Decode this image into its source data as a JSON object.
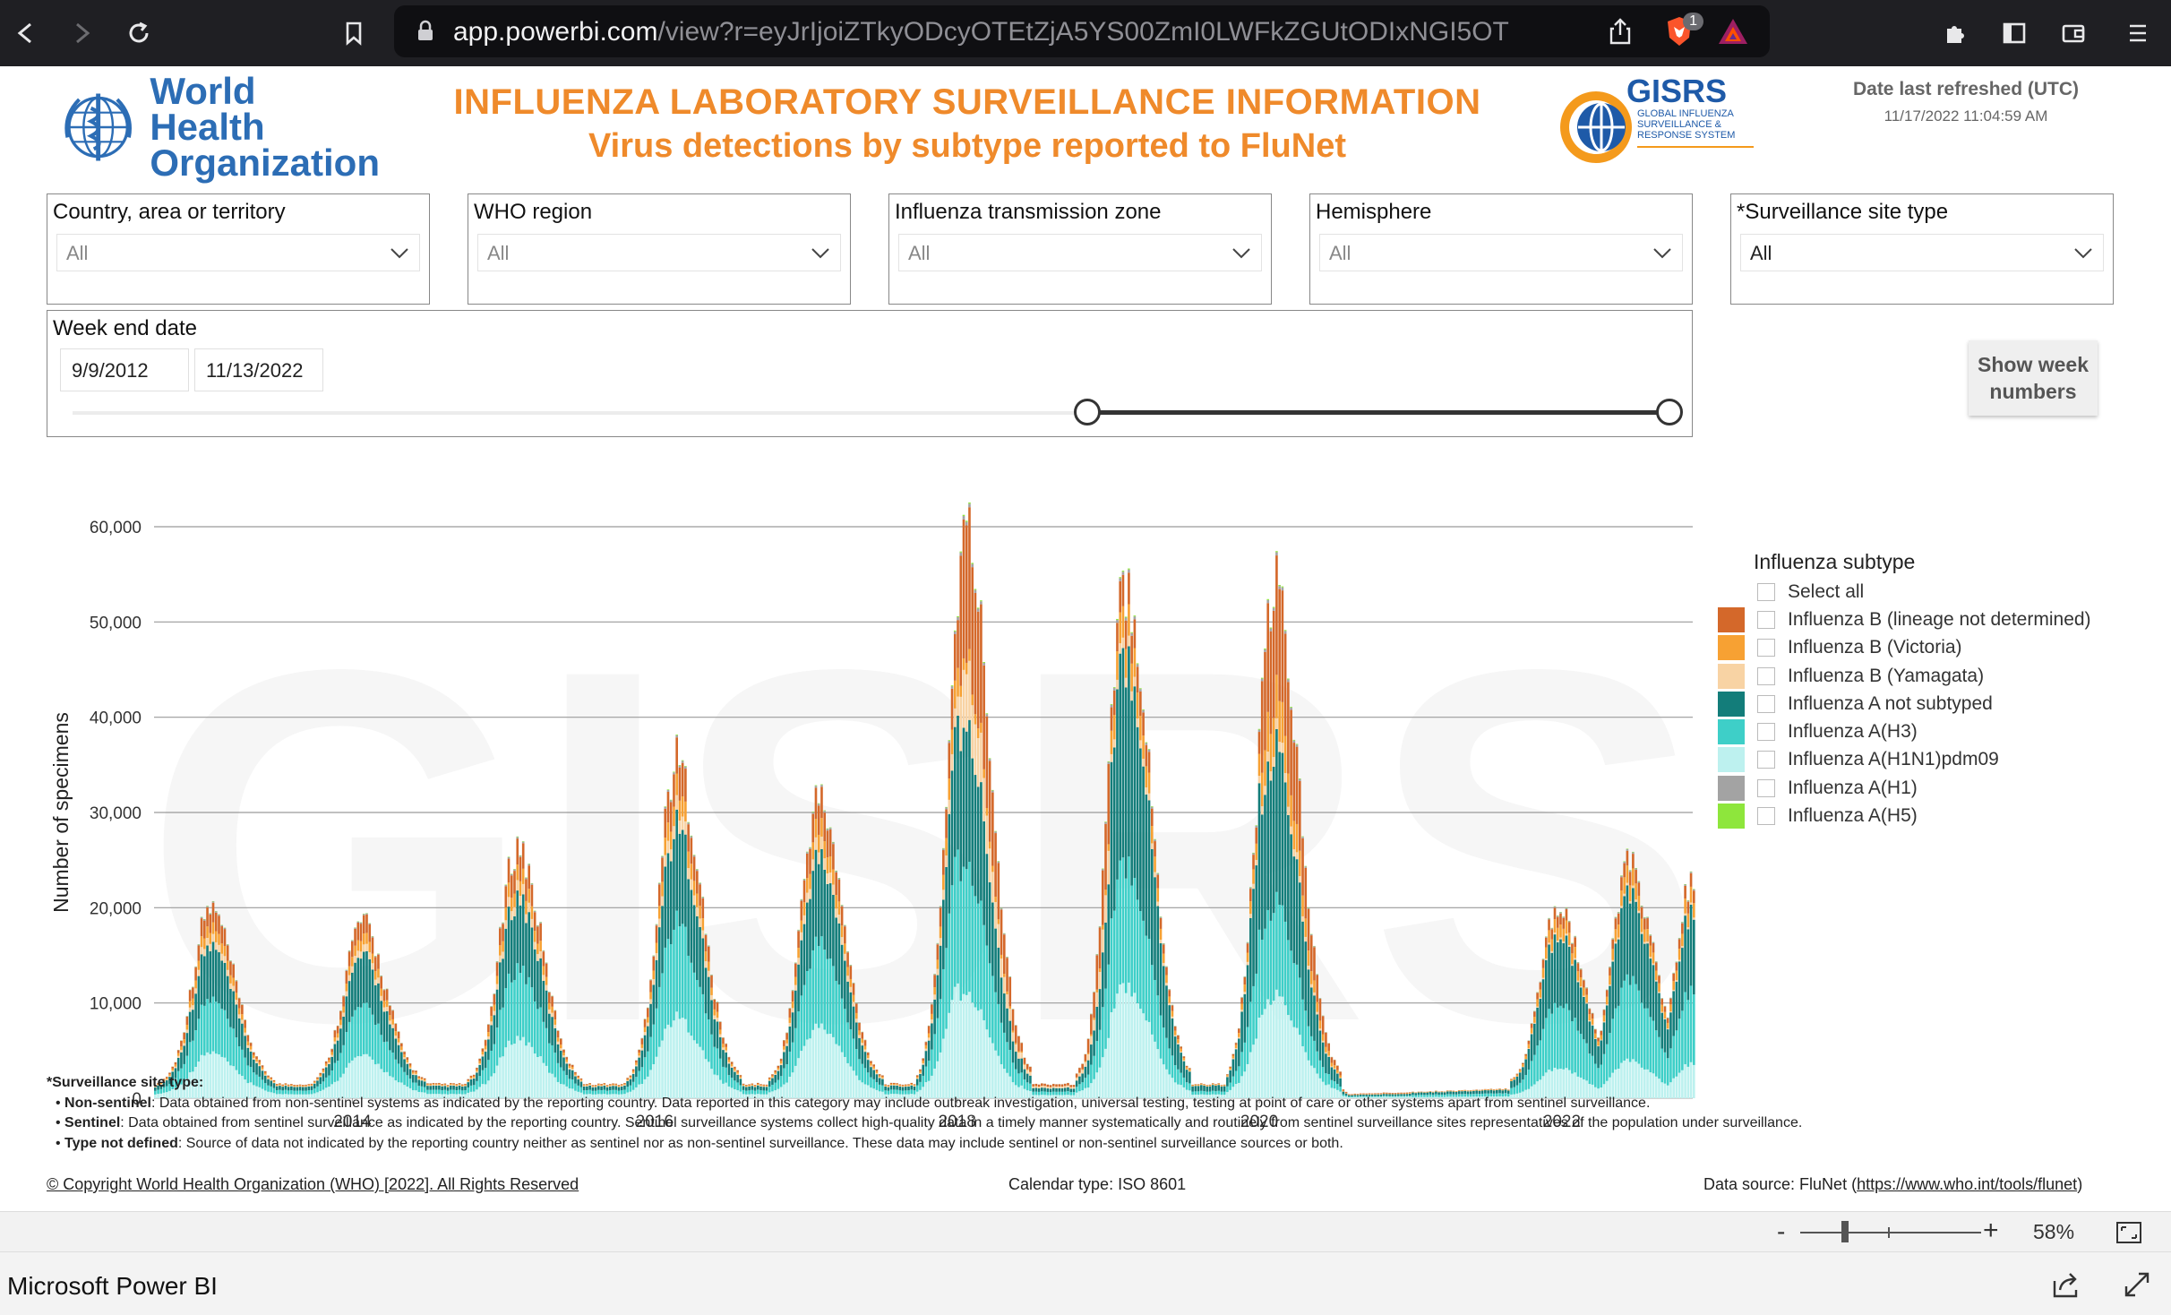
{
  "browser": {
    "url_host": "app.powerbi.com",
    "url_rest": "/view?r=eyJrIjoiZTkyODcyOTEtZjA5YS00ZmI0LWFkZGUtODIxNGI5OTE3Yj...",
    "brave_badge": "1",
    "icons": [
      "back-icon",
      "forward-icon",
      "reload-icon",
      "bookmark-icon",
      "lock-icon",
      "share-icon",
      "brave-shield-icon",
      "bat-rewards-icon",
      "extensions-icon",
      "sidebar-icon",
      "wallet-icon",
      "menu-icon"
    ]
  },
  "header": {
    "who_line1": "World Health",
    "who_line2": "Organization",
    "title": "INFLUENZA LABORATORY SURVEILLANCE INFORMATION",
    "subtitle": "Virus detections by subtype reported to FluNet",
    "gisrs_name": "GISRS",
    "gisrs_full": "GLOBAL INFLUENZA SURVEILLANCE & RESPONSE SYSTEM",
    "refresh_label": "Date last refreshed (UTC)",
    "refresh_value": "11/17/2022 11:04:59 AM"
  },
  "filters": [
    {
      "label": "Country, area or territory",
      "value": "All"
    },
    {
      "label": "WHO region",
      "value": "All"
    },
    {
      "label": "Influenza transmission zone",
      "value": "All"
    },
    {
      "label": "Hemisphere",
      "value": "All"
    },
    {
      "label": "*Surveillance site type",
      "value": "All"
    }
  ],
  "date_slicer": {
    "label": "Week end date",
    "start": "9/9/2012",
    "end": "11/13/2022"
  },
  "week_button": "Show week numbers",
  "legend": {
    "title": "Influenza subtype",
    "select_all": "Select all",
    "items": [
      {
        "label": "Influenza B (lineage not determined)",
        "color": "#d4682a"
      },
      {
        "label": "Influenza B (Victoria)",
        "color": "#f7a133"
      },
      {
        "label": "Influenza B (Yamagata)",
        "color": "#f8d3a4"
      },
      {
        "label": "Influenza A not subtyped",
        "color": "#137d7a"
      },
      {
        "label": "Influenza A(H3)",
        "color": "#3ecfc8"
      },
      {
        "label": "Influenza A(H1N1)pdm09",
        "color": "#bdf1ef"
      },
      {
        "label": "Influenza A(H1)",
        "color": "#a3a3a3"
      },
      {
        "label": "Influenza A(H5)",
        "color": "#8ee63c"
      }
    ]
  },
  "chart_data": {
    "type": "bar",
    "stacked": true,
    "ylabel": "Number of specimens",
    "xlabel": "",
    "ylim": [
      0,
      60000
    ],
    "yticks": [
      "0",
      "10,000",
      "20,000",
      "30,000",
      "40,000",
      "50,000",
      "60,000"
    ],
    "xticks": [
      "2014",
      "2016",
      "2018",
      "2020",
      "2022"
    ],
    "xlim": [
      "2012-09-09",
      "2022-11-13"
    ],
    "watermark": "GISRS",
    "peaks": [
      {
        "date": "2013-01-20",
        "total": 18500
      },
      {
        "date": "2014-01-20",
        "total": 17000
      },
      {
        "date": "2015-02-01",
        "total": 25000
      },
      {
        "date": "2016-02-20",
        "total": 34000
      },
      {
        "date": "2017-01-28",
        "total": 30000
      },
      {
        "date": "2018-01-20",
        "total": 58000
      },
      {
        "date": "2019-02-10",
        "total": 53000
      },
      {
        "date": "2020-02-05",
        "total": 52000
      },
      {
        "date": "2021-12-20",
        "total": 19000
      },
      {
        "date": "2022-06-10",
        "total": 23000
      },
      {
        "date": "2022-11-13",
        "total": 22000
      }
    ]
  },
  "notes": {
    "heading": "*Surveillance site type:",
    "lines": [
      {
        "term": "Non-sentinel",
        "text": ": Data obtained from non-sentinel systems as indicated by the reporting country. Data reported in this category may include outbreak investigation, universal testing, testing at point of care or other systems apart from sentinel surveillance."
      },
      {
        "term": "Sentinel",
        "text": ": Data obtained from sentinel surveillance as indicated by the reporting country. Sentinel surveillance systems collect high-quality data in a timely manner systematically and routinely from sentinel surveillance sites representatives of the population under surveillance."
      },
      {
        "term": "Type not defined",
        "text": ": Source of data not indicated by the reporting country neither as sentinel nor as non-sentinel surveillance. These data may include sentinel or non-sentinel surveillance sources or both."
      }
    ]
  },
  "footer": {
    "copyright": "© Copyright World Health Organization (WHO) [2022]. All Rights Reserved",
    "calendar": "Calendar type: ISO 8601",
    "source_prefix": "Data source: FluNet (",
    "source_link": "https://www.who.int/tools/flunet",
    "source_suffix": ")"
  },
  "zoom": {
    "minus": "-",
    "plus": "+",
    "percent": "58%"
  },
  "app": {
    "name": "Microsoft Power BI"
  }
}
